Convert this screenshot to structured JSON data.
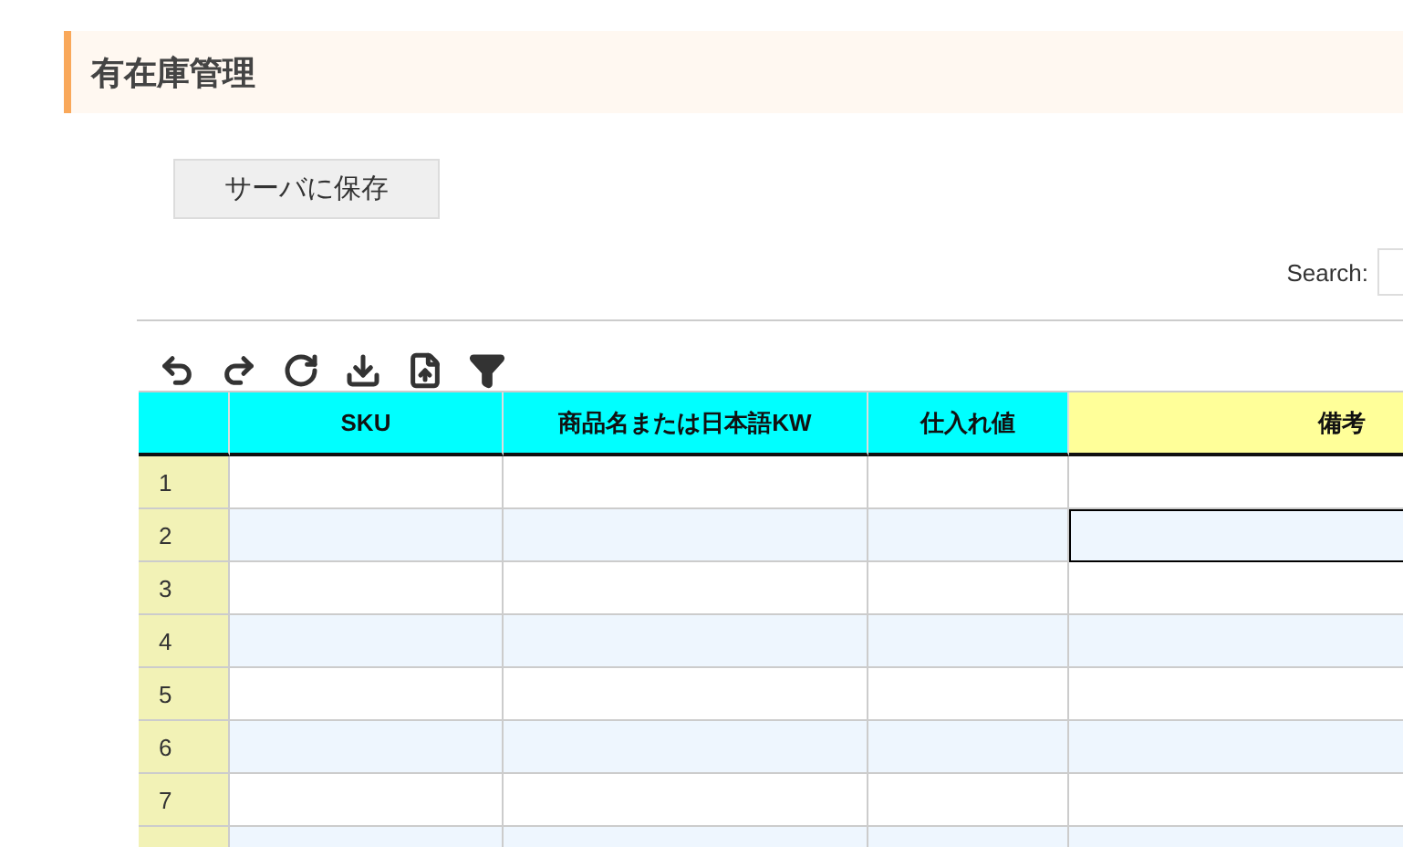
{
  "page_title": "有在庫管理",
  "save_button": "サーバに保存",
  "search": {
    "label": "Search:"
  },
  "toolbar": [
    {
      "kind": "undo"
    },
    {
      "kind": "redo"
    },
    {
      "kind": "refresh"
    },
    {
      "kind": "download"
    },
    {
      "kind": "upload"
    },
    {
      "kind": "filter"
    }
  ],
  "table": {
    "columns": [
      {
        "label": "SKU",
        "kind": "normal"
      },
      {
        "label": "商品名または日本語KW",
        "kind": "normal"
      },
      {
        "label": "仕入れ値",
        "kind": "normal"
      },
      {
        "label": "備考",
        "kind": "note"
      }
    ],
    "rows": [
      {
        "number": "1",
        "remarks_selected": false
      },
      {
        "number": "2",
        "remarks_selected": true
      },
      {
        "number": "3",
        "remarks_selected": false
      },
      {
        "number": "4",
        "remarks_selected": false
      },
      {
        "number": "5",
        "remarks_selected": false
      },
      {
        "number": "6",
        "remarks_selected": false
      },
      {
        "number": "7",
        "remarks_selected": false
      },
      {
        "remarks_selected": false
      }
    ]
  }
}
